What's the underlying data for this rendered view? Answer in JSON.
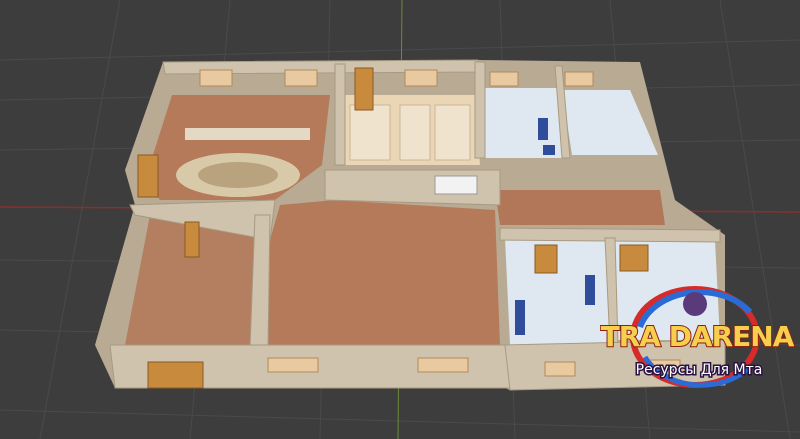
{
  "scene": {
    "background": "#3d3d3d",
    "axis_x_color": "#8b2e2e",
    "axis_y_color": "#5f8a2e",
    "floor_wood": "#b57a5a",
    "wall_color": "#cfc3ad",
    "tile_color": "#dfe8f0"
  },
  "logo": {
    "title": "TRA DARENA",
    "subtitle": "Ресурсы Для Мта",
    "ring_red": "#d62b2b",
    "ring_blue": "#2a6bd6",
    "title_color": "#f6d04d"
  }
}
